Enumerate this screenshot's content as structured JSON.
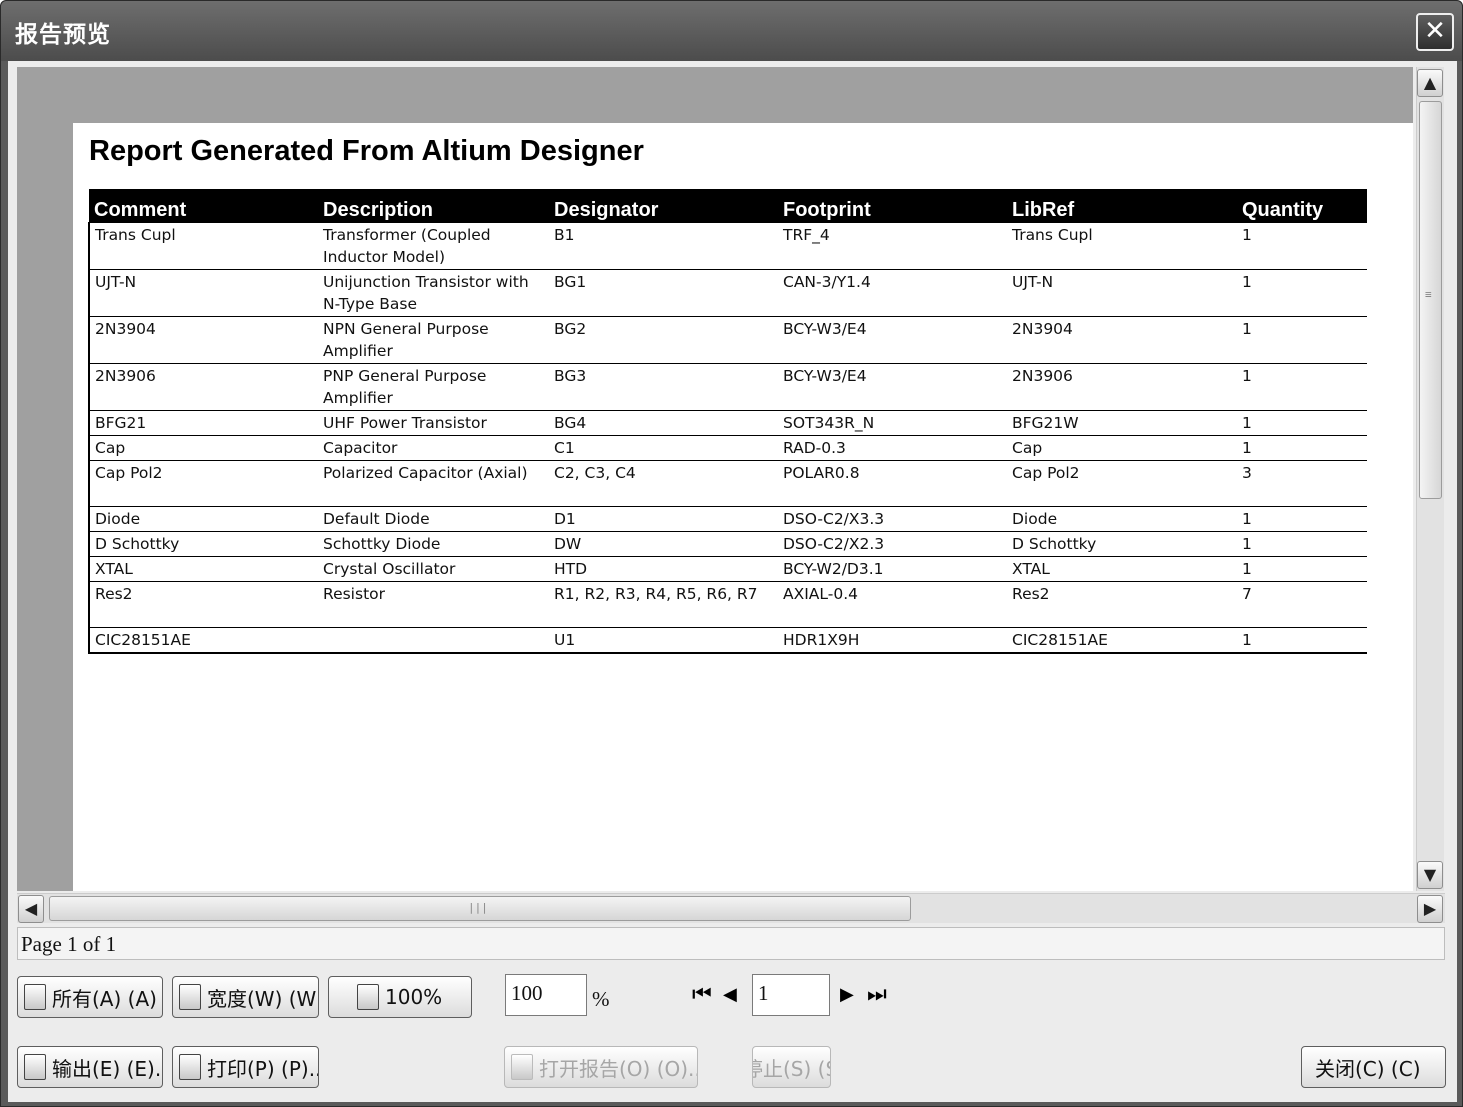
{
  "window": {
    "title": "报告预览",
    "close_glyph": "✕"
  },
  "report": {
    "title": "Report Generated From Altium Designer",
    "columns": [
      "Comment",
      "Description",
      "Designator",
      "Footprint",
      "LibRef",
      "Quantity"
    ],
    "rows": [
      {
        "comment": "Trans Cupl",
        "description": "Transformer (Coupled Inductor Model)",
        "designator": "B1",
        "footprint": "TRF_4",
        "libref": "Trans Cupl",
        "quantity": "1"
      },
      {
        "comment": "UJT-N",
        "description": "Unijunction Transistor with N-Type Base",
        "designator": "BG1",
        "footprint": "CAN-3/Y1.4",
        "libref": "UJT-N",
        "quantity": "1"
      },
      {
        "comment": "2N3904",
        "description": "NPN General Purpose Amplifier",
        "designator": "BG2",
        "footprint": "BCY-W3/E4",
        "libref": "2N3904",
        "quantity": "1"
      },
      {
        "comment": "2N3906",
        "description": "PNP General Purpose Amplifier",
        "designator": "BG3",
        "footprint": "BCY-W3/E4",
        "libref": "2N3906",
        "quantity": "1"
      },
      {
        "comment": "BFG21",
        "description": "UHF Power Transistor",
        "designator": "BG4",
        "footprint": "SOT343R_N",
        "libref": "BFG21W",
        "quantity": "1"
      },
      {
        "comment": "Cap",
        "description": "Capacitor",
        "designator": "C1",
        "footprint": "RAD-0.3",
        "libref": "Cap",
        "quantity": "1"
      },
      {
        "comment": "Cap Pol2",
        "description": "Polarized Capacitor (Axial)",
        "designator": "C2, C3, C4",
        "footprint": "POLAR0.8",
        "libref": "Cap Pol2",
        "quantity": "3"
      },
      {
        "comment": "Diode",
        "description": "Default Diode",
        "designator": "D1",
        "footprint": "DSO-C2/X3.3",
        "libref": "Diode",
        "quantity": "1"
      },
      {
        "comment": "D Schottky",
        "description": "Schottky Diode",
        "designator": "DW",
        "footprint": "DSO-C2/X2.3",
        "libref": "D Schottky",
        "quantity": "1"
      },
      {
        "comment": "XTAL",
        "description": "Crystal Oscillator",
        "designator": "HTD",
        "footprint": "BCY-W2/D3.1",
        "libref": "XTAL",
        "quantity": "1"
      },
      {
        "comment": "Res2",
        "description": "Resistor",
        "designator": "R1, R2, R3, R4, R5, R6, R7",
        "footprint": "AXIAL-0.4",
        "libref": "Res2",
        "quantity": "7"
      },
      {
        "comment": "CIC28151AE",
        "description": "",
        "designator": "U1",
        "footprint": "HDR1X9H",
        "libref": "CIC28151AE",
        "quantity": "1"
      }
    ]
  },
  "status": {
    "page_text": "Page 1 of 1"
  },
  "toolbar": {
    "all_label": "所有(A) (A)",
    "width_label": "宽度(W) (W)",
    "zoom100_label": "100%",
    "zoom_value": "100",
    "zoom_unit": "%",
    "page_value": "1",
    "first_glyph": "⏮",
    "prev_glyph": "◀",
    "next_glyph": "▶",
    "last_glyph": "⏭",
    "export_label": "输出(E) (E)...",
    "print_label": "打印(P) (P)...",
    "open_report_label": "打开报告(O) (O)...",
    "stop_label": "停止(S) (S)",
    "close_label": "关闭(C) (C)"
  },
  "scroll": {
    "up": "▲",
    "down": "▼",
    "left": "◀",
    "right": "▶",
    "grip_v": "≡",
    "grip_h": "|||"
  },
  "icons": {
    "close": "close-icon",
    "all": "page-icon",
    "width": "page-width-icon",
    "zoom": "zoom-page-icon",
    "export": "export-icon",
    "print": "printer-icon",
    "open": "open-report-icon"
  }
}
